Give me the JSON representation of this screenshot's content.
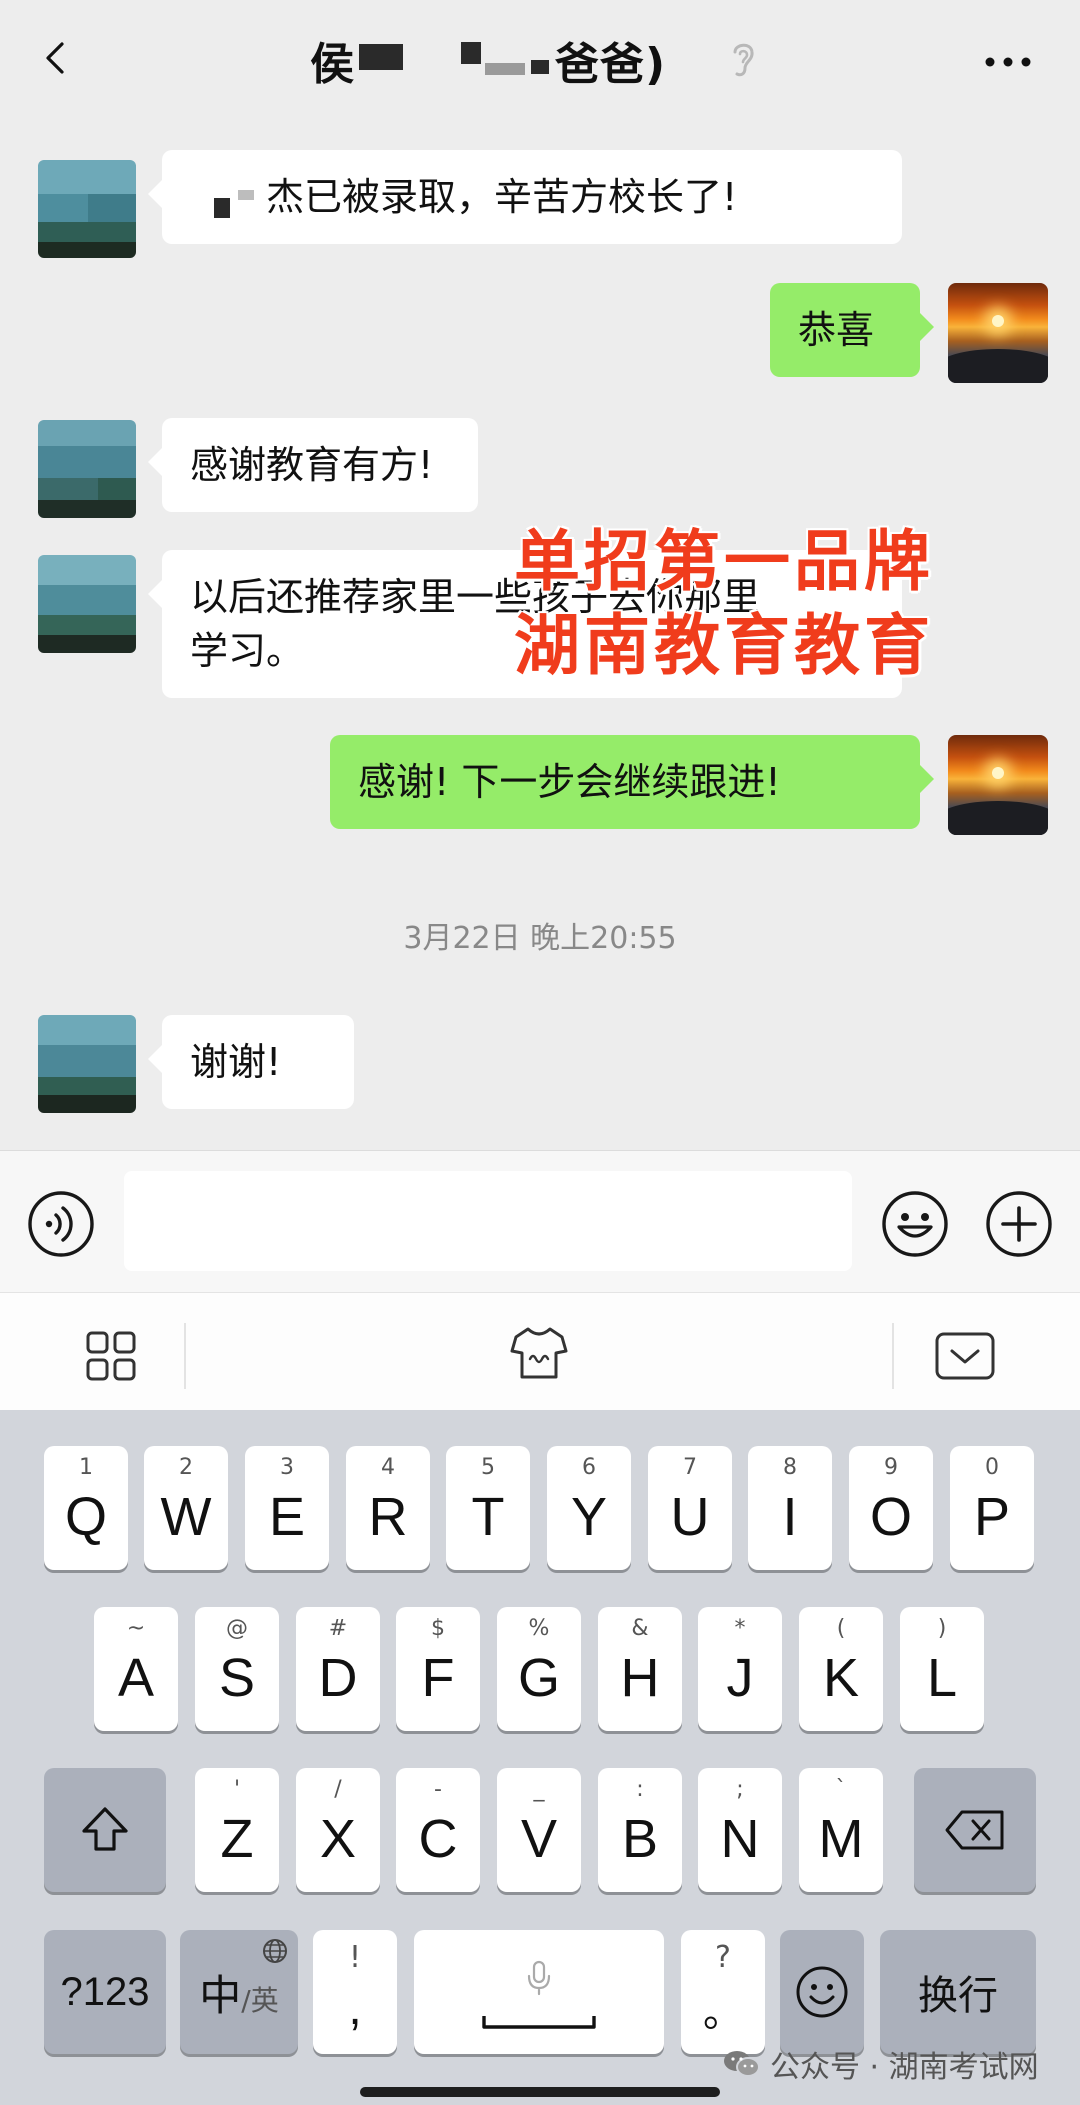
{
  "header": {
    "title_part1": "侯",
    "title_part2": "爸爸)",
    "more_icon": "more-icon",
    "back_icon": "back-icon",
    "ear_icon": "ear-icon"
  },
  "messages": [
    {
      "side": "in",
      "text": "杰已被录取，辛苦方校长了!"
    },
    {
      "side": "out",
      "text": "恭喜"
    },
    {
      "side": "in",
      "text": "感谢教育有方!"
    },
    {
      "side": "in",
      "text_line1": "以后还推荐家里一些孩子去你那里",
      "text_line2": "学习。"
    },
    {
      "side": "out",
      "text": "感谢! 下一步会继续跟进!"
    },
    {
      "side": "in",
      "text": "谢谢!"
    }
  ],
  "timestamp": "3月22日 晚上20:55",
  "overlay": {
    "line1": "单招第一品牌",
    "line2": "湖南教育教育",
    "color": "#f03c1c"
  },
  "colors": {
    "outgoing_bubble": "#95ec69",
    "incoming_bubble": "#ffffff",
    "background": "#ededed"
  },
  "keyboard": {
    "row1": [
      {
        "sym": "1",
        "key": "Q"
      },
      {
        "sym": "2",
        "key": "W"
      },
      {
        "sym": "3",
        "key": "E"
      },
      {
        "sym": "4",
        "key": "R"
      },
      {
        "sym": "5",
        "key": "T"
      },
      {
        "sym": "6",
        "key": "Y"
      },
      {
        "sym": "7",
        "key": "U"
      },
      {
        "sym": "8",
        "key": "I"
      },
      {
        "sym": "9",
        "key": "O"
      },
      {
        "sym": "0",
        "key": "P"
      }
    ],
    "row2": [
      {
        "sym": "~",
        "key": "A"
      },
      {
        "sym": "@",
        "key": "S"
      },
      {
        "sym": "#",
        "key": "D"
      },
      {
        "sym": "$",
        "key": "F"
      },
      {
        "sym": "%",
        "key": "G"
      },
      {
        "sym": "&",
        "key": "H"
      },
      {
        "sym": "*",
        "key": "J"
      },
      {
        "sym": "(",
        "key": "K"
      },
      {
        "sym": ")",
        "key": "L"
      }
    ],
    "row3": [
      {
        "sym": "'",
        "key": "Z"
      },
      {
        "sym": "/",
        "key": "X"
      },
      {
        "sym": "-",
        "key": "C"
      },
      {
        "sym": "_",
        "key": "V"
      },
      {
        "sym": ":",
        "key": "B"
      },
      {
        "sym": ";",
        "key": "N"
      },
      {
        "sym": "`",
        "key": "M"
      }
    ],
    "numeric_key": "?123",
    "lang_main": "中",
    "lang_alt": "/英",
    "comma_sym": "!",
    "comma_key": ",",
    "period_sym": "?",
    "period_key": "。",
    "return_key": "换行"
  },
  "watermark": "公众号 · 湖南考试网"
}
